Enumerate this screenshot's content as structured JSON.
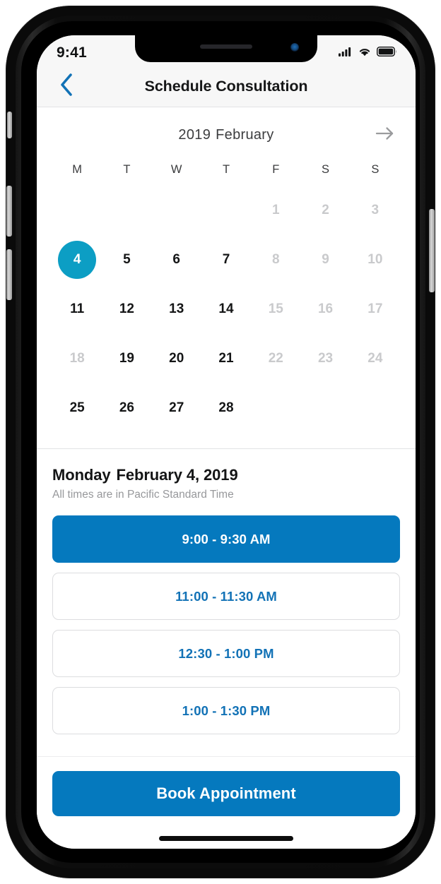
{
  "theme": {
    "accent_blue": "#0579BE",
    "accent_teal": "#0C9EC4",
    "link_blue": "#1272B6",
    "muted_gray": "#c9cacc",
    "arrow_gray": "#9a9b9d"
  },
  "status_bar": {
    "time": "9:41",
    "cellular_icon": "cellular-bars-icon",
    "wifi_icon": "wifi-icon",
    "battery_icon": "battery-full-icon"
  },
  "nav": {
    "back_icon": "chevron-left-icon",
    "title": "Schedule Consultation"
  },
  "calendar": {
    "year": "2019",
    "month": "February",
    "next_icon": "arrow-right-icon",
    "weekdays": [
      "M",
      "T",
      "W",
      "T",
      "F",
      "S",
      "S"
    ],
    "leading_blanks": 4,
    "selected_day": 4,
    "days": [
      {
        "n": "1",
        "state": "muted"
      },
      {
        "n": "2",
        "state": "muted"
      },
      {
        "n": "3",
        "state": "muted"
      },
      {
        "n": "4",
        "state": "selected"
      },
      {
        "n": "5",
        "state": "available"
      },
      {
        "n": "6",
        "state": "available"
      },
      {
        "n": "7",
        "state": "available"
      },
      {
        "n": "8",
        "state": "muted"
      },
      {
        "n": "9",
        "state": "muted"
      },
      {
        "n": "10",
        "state": "muted"
      },
      {
        "n": "11",
        "state": "available"
      },
      {
        "n": "12",
        "state": "available"
      },
      {
        "n": "13",
        "state": "available"
      },
      {
        "n": "14",
        "state": "available"
      },
      {
        "n": "15",
        "state": "muted"
      },
      {
        "n": "16",
        "state": "muted"
      },
      {
        "n": "17",
        "state": "muted"
      },
      {
        "n": "18",
        "state": "muted"
      },
      {
        "n": "19",
        "state": "available"
      },
      {
        "n": "20",
        "state": "available"
      },
      {
        "n": "21",
        "state": "available"
      },
      {
        "n": "22",
        "state": "muted"
      },
      {
        "n": "23",
        "state": "muted"
      },
      {
        "n": "24",
        "state": "muted"
      },
      {
        "n": "25",
        "state": "available"
      },
      {
        "n": "26",
        "state": "available"
      },
      {
        "n": "27",
        "state": "available"
      },
      {
        "n": "28",
        "state": "available"
      }
    ]
  },
  "slots_section": {
    "weekday_name": "Monday",
    "date_text": "February 4, 2019",
    "subtitle": "All times are in Pacific Standard Time",
    "slots": [
      {
        "label": "9:00 - 9:30 AM",
        "state": "selected"
      },
      {
        "label": "11:00 - 11:30 AM",
        "state": "unselected"
      },
      {
        "label": "12:30 - 1:00 PM",
        "state": "unselected"
      },
      {
        "label": "1:00 - 1:30 PM",
        "state": "unselected"
      }
    ]
  },
  "footer": {
    "book_label": "Book Appointment"
  }
}
